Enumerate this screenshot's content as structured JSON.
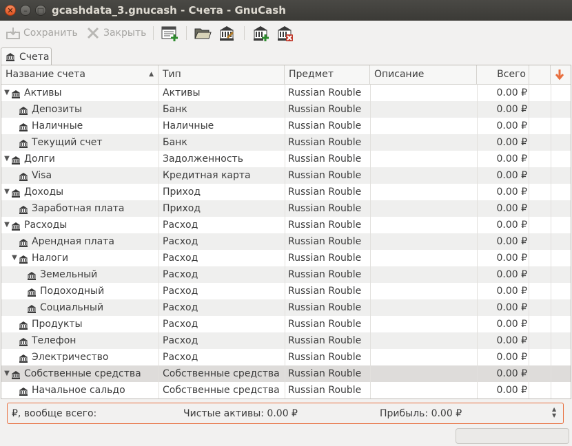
{
  "window": {
    "title": "gcashdata_3.gnucash - Счета - GnuCash"
  },
  "toolbar": {
    "save_label": "Сохранить",
    "close_label": "Закрыть"
  },
  "tab": {
    "label": "Счета"
  },
  "columns": {
    "name": "Название счета",
    "type": "Тип",
    "commodity": "Предмет",
    "description": "Описание",
    "total": "Всего"
  },
  "accounts": [
    {
      "name": "Активы",
      "type": "Активы",
      "commodity": "Russian Rouble",
      "total": "0.00 ₽",
      "depth": 0,
      "expander": "open"
    },
    {
      "name": "Депозиты",
      "type": "Банк",
      "commodity": "Russian Rouble",
      "total": "0.00 ₽",
      "depth": 1,
      "expander": "none"
    },
    {
      "name": "Наличные",
      "type": "Наличные",
      "commodity": "Russian Rouble",
      "total": "0.00 ₽",
      "depth": 1,
      "expander": "none"
    },
    {
      "name": "Текущий счет",
      "type": "Банк",
      "commodity": "Russian Rouble",
      "total": "0.00 ₽",
      "depth": 1,
      "expander": "none"
    },
    {
      "name": "Долги",
      "type": "Задолженность",
      "commodity": "Russian Rouble",
      "total": "0.00 ₽",
      "depth": 0,
      "expander": "open"
    },
    {
      "name": "Visa",
      "type": "Кредитная карта",
      "commodity": "Russian Rouble",
      "total": "0.00 ₽",
      "depth": 1,
      "expander": "none"
    },
    {
      "name": "Доходы",
      "type": "Приход",
      "commodity": "Russian Rouble",
      "total": "0.00 ₽",
      "depth": 0,
      "expander": "open"
    },
    {
      "name": "Заработная плата",
      "type": "Приход",
      "commodity": "Russian Rouble",
      "total": "0.00 ₽",
      "depth": 1,
      "expander": "none"
    },
    {
      "name": "Расходы",
      "type": "Расход",
      "commodity": "Russian Rouble",
      "total": "0.00 ₽",
      "depth": 0,
      "expander": "open"
    },
    {
      "name": "Арендная плата",
      "type": "Расход",
      "commodity": "Russian Rouble",
      "total": "0.00 ₽",
      "depth": 1,
      "expander": "none"
    },
    {
      "name": "Налоги",
      "type": "Расход",
      "commodity": "Russian Rouble",
      "total": "0.00 ₽",
      "depth": 1,
      "expander": "open"
    },
    {
      "name": "Земельный",
      "type": "Расход",
      "commodity": "Russian Rouble",
      "total": "0.00 ₽",
      "depth": 2,
      "expander": "none"
    },
    {
      "name": "Подоходный",
      "type": "Расход",
      "commodity": "Russian Rouble",
      "total": "0.00 ₽",
      "depth": 2,
      "expander": "none"
    },
    {
      "name": "Социальный",
      "type": "Расход",
      "commodity": "Russian Rouble",
      "total": "0.00 ₽",
      "depth": 2,
      "expander": "none"
    },
    {
      "name": "Продукты",
      "type": "Расход",
      "commodity": "Russian Rouble",
      "total": "0.00 ₽",
      "depth": 1,
      "expander": "none"
    },
    {
      "name": "Телефон",
      "type": "Расход",
      "commodity": "Russian Rouble",
      "total": "0.00 ₽",
      "depth": 1,
      "expander": "none"
    },
    {
      "name": "Электричество",
      "type": "Расход",
      "commodity": "Russian Rouble",
      "total": "0.00 ₽",
      "depth": 1,
      "expander": "none"
    },
    {
      "name": "Собственные средства",
      "type": "Собственные средства",
      "commodity": "Russian Rouble",
      "total": "0.00 ₽",
      "depth": 0,
      "expander": "open",
      "selected": true
    },
    {
      "name": "Начальное сальдо",
      "type": "Собственные средства",
      "commodity": "Russian Rouble",
      "total": "0.00 ₽",
      "depth": 1,
      "expander": "none"
    }
  ],
  "summary": {
    "currency_label": "₽, вообще всего:",
    "net_assets": "Чистые активы: 0.00 ₽",
    "profit": "Прибыль: 0.00 ₽"
  },
  "colors": {
    "accent": "#e86f3f",
    "selected_row": "#dedcda",
    "alt_row": "#efefee"
  }
}
